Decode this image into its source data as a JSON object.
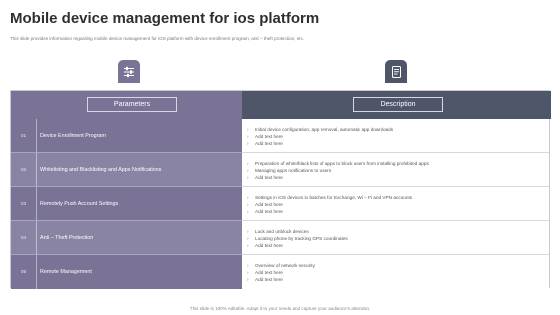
{
  "slide": {
    "title": "Mobile device management for ios platform",
    "subtitle": "This slide provides information regarding mobile device management for iOS platform with device enrollment program, anti – theft protection, etc.",
    "footer": "This slide is 100% editable. Adapt it to your needs and capture your audience's attention."
  },
  "icons": {
    "left": "settings-sliders-icon",
    "right": "document-icon"
  },
  "colors": {
    "param_header": "#7a7396",
    "desc_header": "#4f566a"
  },
  "table": {
    "headers": {
      "parameters": "Parameters",
      "description": "Description"
    },
    "rows": [
      {
        "num": "01",
        "param": "Device Enrollment Program",
        "lines": [
          "Initial device configuration, app removal, automatic app downloads",
          "Add text here",
          "Add text here"
        ]
      },
      {
        "num": "02",
        "param": "Whitelisting and Blacklisting and Apps Notifications",
        "lines": [
          "Preparation of white/black lists of apps to block users from installing prohibited apps",
          "Managing apps notifications to users",
          "Add text here"
        ]
      },
      {
        "num": "03",
        "param": "Remotely Push Account Settings",
        "lines": [
          "Settings in iOS devices in batches for Exchange, Wi – Fi and VPN accounts",
          "Add text here",
          "Add text here"
        ]
      },
      {
        "num": "04",
        "param": "Anti – Theft Protection",
        "lines": [
          "Lock and unblock devices",
          "Locating phone by tracking GPS coordinates",
          "Add text here"
        ]
      },
      {
        "num": "05",
        "param": "Remote Management",
        "lines": [
          "Overview of network security",
          "Add text here",
          "Add text here"
        ]
      }
    ]
  }
}
